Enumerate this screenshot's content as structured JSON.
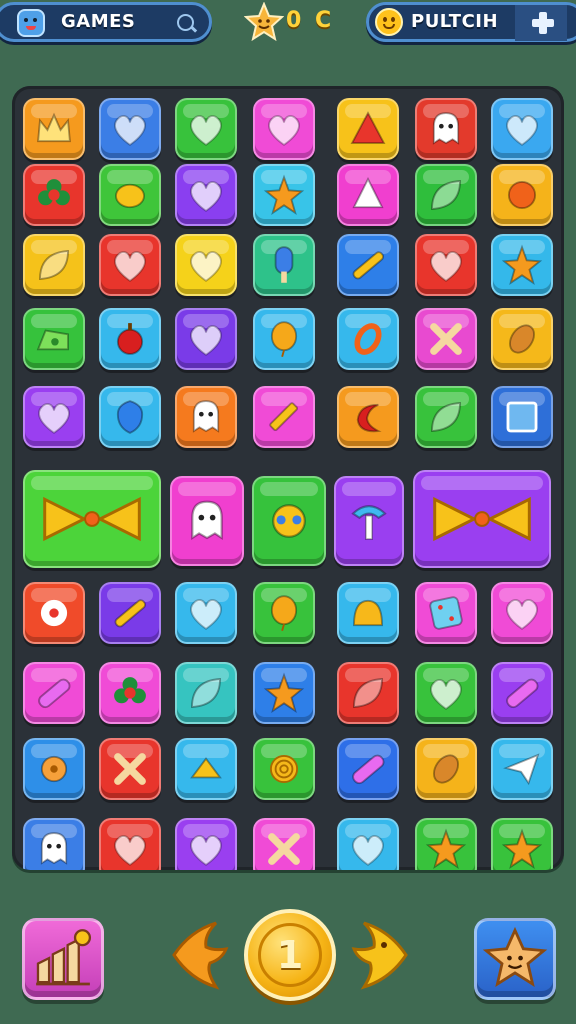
{
  "header": {
    "games_label": "GAMES",
    "center_label": "0 C",
    "right_label": "PULTCIH"
  },
  "board": {
    "rows": [
      [
        "#f59a1e",
        "#3b7ee6",
        "#38c23c",
        "#f04bd6",
        "#f7c21a",
        "#e33a2c",
        "#3aa8f0"
      ],
      [
        "#e8352c",
        "#3fc53a",
        "#8a3ff0",
        "#38c4e8",
        "#f03fcf",
        "#2fbe3c",
        "#f5b31a"
      ],
      [
        "#f5c21a",
        "#e8352c",
        "#f5d21a",
        "#2ec28a",
        "#2e7fe8",
        "#e8352c",
        "#34b8ea"
      ],
      [
        "#36c23c",
        "#36b8ec",
        "#7a3be8",
        "#36b8ec",
        "#36b8ec",
        "#e84ad0",
        "#f5b81a"
      ],
      [
        "#9a3ff0",
        "#36b8ec",
        "#f57a1e",
        "#f04bd6",
        "#f59a1e",
        "#38c23c",
        "#2e6fd8"
      ],
      [
        "#f04b2a",
        "#7a3be8",
        "#36b8ec",
        "#38c23c",
        "#36b8ec",
        "#f04bd6",
        "#f04bd6"
      ],
      [
        "#f04bd6",
        "#f04bd6",
        "#36c4c0",
        "#2e7fe8",
        "#e8352c",
        "#38c23c",
        "#9a3ff0"
      ],
      [
        "#2e8fe8",
        "#e8352c",
        "#36b8ec",
        "#38c23c",
        "#2e6fe8",
        "#f5b31a",
        "#36b8ec"
      ],
      [
        "#3b7ee6",
        "#e8352c",
        "#9a3ff0",
        "#f04bd6",
        "#36b8ec",
        "#38c23c",
        "#38c23c"
      ]
    ],
    "icons": [
      [
        "crown",
        "heart",
        "heart",
        "heart",
        "cone",
        "ghost",
        "heart"
      ],
      [
        "flower",
        "blob",
        "heart",
        "star",
        "triangle",
        "leaf",
        "ball"
      ],
      [
        "leaf",
        "heart",
        "heart",
        "popsicle",
        "stick",
        "heart",
        "star"
      ],
      [
        "cheese",
        "apple",
        "heart",
        "balloon",
        "ring",
        "cross",
        "almond"
      ],
      [
        "heart",
        "shield",
        "ghost",
        "pencil",
        "moon",
        "leaf",
        "frame"
      ],
      [
        "donut",
        "stick",
        "heart",
        "balloon",
        "dome",
        "dice",
        "heart"
      ],
      [
        "pill",
        "flower",
        "leaf",
        "star",
        "leaf",
        "heart",
        "pill"
      ],
      [
        "gear",
        "cross",
        "chevron",
        "swirl",
        "pill",
        "almond",
        "paper-plane"
      ],
      [
        "ghost",
        "heart",
        "heart",
        "cross",
        "heart",
        "star",
        "star"
      ]
    ],
    "special_tiles": [
      {
        "color": "#4cd43a",
        "icon": "bow"
      },
      {
        "color": "#f03fcf",
        "icon": "ghost"
      },
      {
        "color": "#36c23c",
        "icon": "virus"
      },
      {
        "color": "#9a3ff0",
        "icon": "hammer"
      },
      {
        "color": "#9a3ff0",
        "icon": "bow"
      }
    ]
  },
  "footer": {
    "level_number": "1",
    "left_button_icon": "chart-icon",
    "right_button_icon": "star-icon"
  }
}
